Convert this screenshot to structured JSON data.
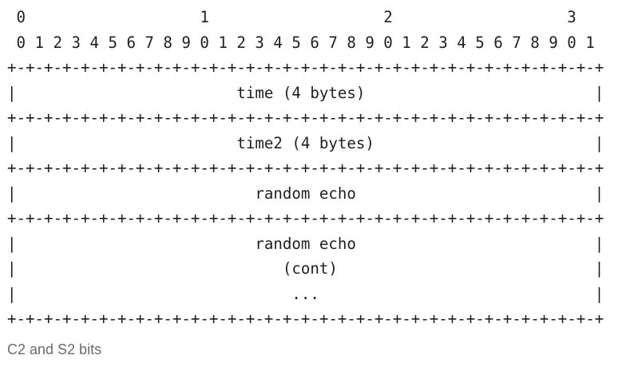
{
  "diagram": {
    "bit_tens_row": " 0                   1                   2                   3",
    "bit_units_row": " 0 1 2 3 4 5 6 7 8 9 0 1 2 3 4 5 6 7 8 9 0 1 2 3 4 5 6 7 8 9 0 1",
    "fields": [
      {
        "separator": "+-+-+-+-+-+-+-+-+-+-+-+-+-+-+-+-+-+-+-+-+-+-+-+-+-+-+-+-+-+-+-+-+",
        "rows": [
          "|                        time (4 bytes)                         |"
        ]
      },
      {
        "separator": "+-+-+-+-+-+-+-+-+-+-+-+-+-+-+-+-+-+-+-+-+-+-+-+-+-+-+-+-+-+-+-+-+",
        "rows": [
          "|                        time2 (4 bytes)                        |"
        ]
      },
      {
        "separator": "+-+-+-+-+-+-+-+-+-+-+-+-+-+-+-+-+-+-+-+-+-+-+-+-+-+-+-+-+-+-+-+-+",
        "rows": [
          "|                          random echo                          |"
        ]
      },
      {
        "separator": "+-+-+-+-+-+-+-+-+-+-+-+-+-+-+-+-+-+-+-+-+-+-+-+-+-+-+-+-+-+-+-+-+",
        "rows": [
          "|                          random echo                          |",
          "|                             (cont)                            |",
          "|                              ...                              |"
        ]
      }
    ],
    "closing_separator": "+-+-+-+-+-+-+-+-+-+-+-+-+-+-+-+-+-+-+-+-+-+-+-+-+-+-+-+-+-+-+-+-+"
  },
  "caption": "C2 and S2 bits"
}
